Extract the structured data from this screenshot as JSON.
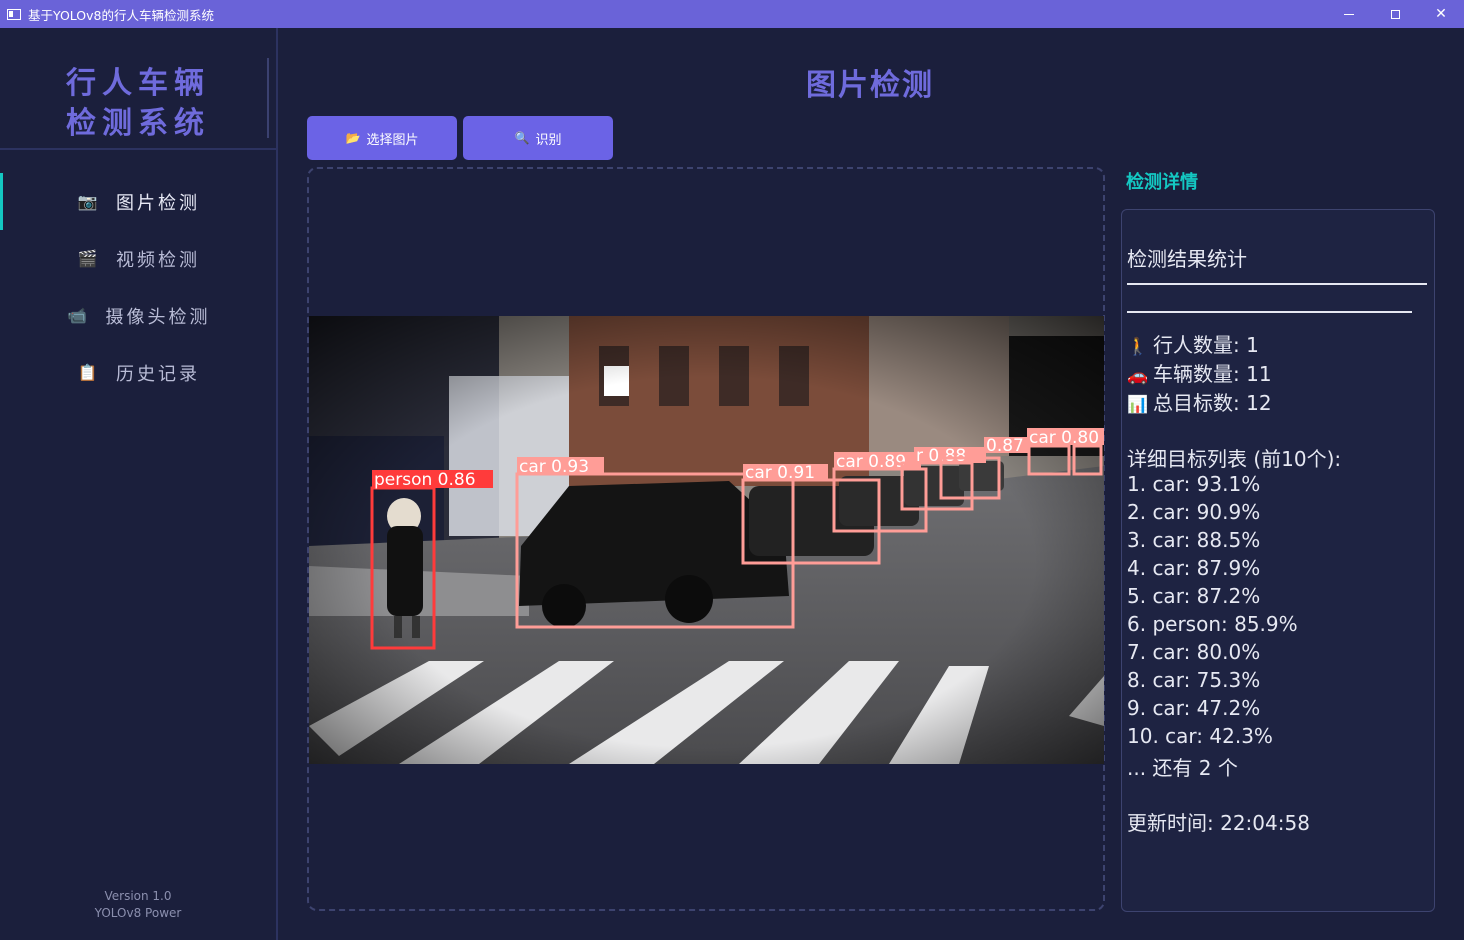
{
  "window": {
    "title": "基于YOLOv8的行人车辆检测系统",
    "controls": {
      "minimize": "—",
      "maximize": "□",
      "close": "✕"
    }
  },
  "sidebar": {
    "logo_line1": "行人车辆",
    "logo_line2": "检测系统",
    "items": [
      {
        "label": "图片检测",
        "icon": "camera-icon",
        "glyph": "📷",
        "active": true
      },
      {
        "label": "视频检测",
        "icon": "clapper-icon",
        "glyph": "🎬",
        "active": false
      },
      {
        "label": "摄像头检测",
        "icon": "video-camera-icon",
        "glyph": "📹",
        "active": false
      },
      {
        "label": "历史记录",
        "icon": "clipboard-icon",
        "glyph": "📋",
        "active": false
      }
    ],
    "version": "Version 1.0",
    "powered": "YOLOv8 Power"
  },
  "main": {
    "title": "图片检测",
    "select_button": {
      "label": "选择图片",
      "icon": "folder-icon",
      "glyph": "📂"
    },
    "detect_button": {
      "label": "识别",
      "icon": "magnifier-icon",
      "glyph": "🔍"
    }
  },
  "detections": [
    {
      "label": "person 0.86",
      "color": "#ff3b3b"
    },
    {
      "label": "car 0.93",
      "color": "#ff9d97"
    },
    {
      "label": "car 0.91",
      "color": "#ff9d97"
    },
    {
      "label": "car 0.89",
      "color": "#ff9d97"
    },
    {
      "label": "r 0.88",
      "color": "#ff9d97"
    },
    {
      "label": "0.87",
      "color": "#ff9d97"
    },
    {
      "label": "car 0.80",
      "color": "#ff9d97"
    }
  ],
  "details": {
    "heading": "检测详情",
    "stats_title": "检测结果统计",
    "pedestrian": {
      "glyph": "🚶",
      "text": "行人数量: 1"
    },
    "vehicle": {
      "glyph": "🚗",
      "text": "车辆数量: 11"
    },
    "total": {
      "glyph": "📊",
      "text": "总目标数: 12"
    },
    "list_title": "详细目标列表 (前10个):",
    "list": [
      "1. car: 93.1%",
      "2. car: 90.9%",
      "3. car: 88.5%",
      "4. car: 87.9%",
      "5. car: 87.2%",
      "6. person: 85.9%",
      "7. car: 80.0%",
      "8. car: 75.3%",
      "9. car: 47.2%",
      "10. car: 42.3%"
    ],
    "more": "... 还有 2 个",
    "updated": "更新时间: 22:04:58"
  },
  "colors": {
    "accent": "#6b63e6",
    "teal": "#14c7c2",
    "bg": "#1b1f3c",
    "titlebar": "#6a63d8"
  }
}
